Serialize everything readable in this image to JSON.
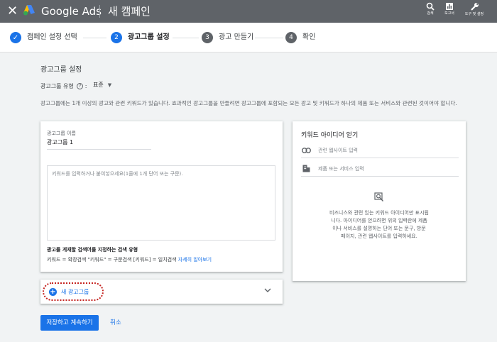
{
  "topbar": {
    "close_symbol": "✕",
    "brand": "Google Ads",
    "title": "새 캠페인",
    "tools": [
      {
        "label": "검색",
        "icon": "search-icon"
      },
      {
        "label": "보고서",
        "icon": "reports-icon"
      },
      {
        "label": "도구 및 설정",
        "icon": "wrench-icon"
      }
    ],
    "bg_color": "#5f6368"
  },
  "stepper": {
    "steps": [
      {
        "number": "✓",
        "label": "캠페인 설정 선택",
        "state": "done"
      },
      {
        "number": "2",
        "label": "광고그룹 설정",
        "state": "active"
      },
      {
        "number": "3",
        "label": "광고 만들기",
        "state": "pending"
      },
      {
        "number": "4",
        "label": "확인",
        "state": "pending"
      }
    ],
    "active_color": "#1a73e8",
    "pending_color": "#5f6368"
  },
  "main": {
    "section_title": "광고그룹 설정",
    "ad_group_type_label": "광고그룹 유형",
    "help_symbol": "?",
    "ad_group_type_value": "표준",
    "description": "광고그룹에는 1개 이상의 광고와 관련 키워드가 있습니다. 효과적인 광고그룹을 만들려면 광고그룹에 포함되는 모든 광고 및 키워드가 하나의 제품 또는 서비스와 관련된 것이어야 합니다."
  },
  "ad_group_card": {
    "name_label": "광고그룹 이름",
    "name_value": "광고그룹 1",
    "keywords_placeholder": "키워드를 입력하거나 붙여넣으세요(1줄에 1개 단어 또는 구문).",
    "match_types_title": "광고를 게재할 검색어를 지정하는 검색 유형",
    "match_types_text": "키워드 = 확장검색  \"키워드\" = 구문검색  [키워드] = 일치검색",
    "learn_more": "자세히 알아보기"
  },
  "add_ad_group": {
    "label": "새 광고그룹",
    "highlight_color": "#c5221f"
  },
  "actions": {
    "save": "저장하고 계속하기",
    "cancel": "취소"
  },
  "keyword_ideas": {
    "title": "키워드 아이디어 얻기",
    "website_placeholder": "관련 웹사이트 입력",
    "product_placeholder": "제품 또는 서비스 입력",
    "empty_text": "비즈니스와 관련 있는 키워드 아이디어만 표시됩니다. 아이디어를 얻으려면 위의 입력란에 제품이나 서비스를 설명하는 단어 또는 문구, 방문 페이지, 관련 웹사이트를 입력하세요."
  }
}
